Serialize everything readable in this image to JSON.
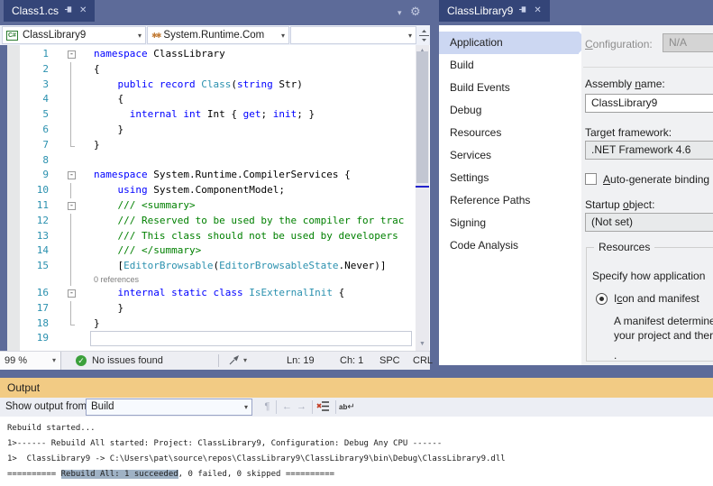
{
  "window": {
    "background": "#5d6b99",
    "active_tab_color": "#344578",
    "output_title_color": "#f2cb84"
  },
  "icons": {
    "chevron_down": "▾",
    "close": "✕",
    "check": "✓",
    "gear": "⚙",
    "up_arrow": "▲",
    "down_arrow": "▼",
    "prev_arrow": "←",
    "next_arrow": "→",
    "find_message": "¶",
    "return_arrow": "↵",
    "wrap_ab": "ab",
    "fold_collapse": "-"
  },
  "left_editor": {
    "tab_title": "Class1.cs",
    "navbar": {
      "project": "ClassLibrary9",
      "type_name": "System.Runtime.Com",
      "member": ""
    },
    "code": {
      "codelens": "0 references",
      "rows": [
        {
          "num": "1",
          "fold": "box",
          "segs": [
            [
              "kw",
              "namespace"
            ],
            [
              "pl",
              " ClassLibrary"
            ]
          ]
        },
        {
          "num": "2",
          "fold": "bar",
          "segs": [
            [
              "pl",
              "{"
            ]
          ]
        },
        {
          "num": "3",
          "fold": "bar",
          "segs": [
            [
              "pl",
              "    "
            ],
            [
              "kw",
              "public"
            ],
            [
              "pl",
              " "
            ],
            [
              "kw",
              "record"
            ],
            [
              "pl",
              " "
            ],
            [
              "ty",
              "Class"
            ],
            [
              "pl",
              "("
            ],
            [
              "kw",
              "string"
            ],
            [
              "pl",
              " Str)"
            ]
          ]
        },
        {
          "num": "4",
          "fold": "bar",
          "segs": [
            [
              "pl",
              "    {"
            ]
          ]
        },
        {
          "num": "5",
          "fold": "bar",
          "segs": [
            [
              "pl",
              "      "
            ],
            [
              "kw",
              "internal"
            ],
            [
              "pl",
              " "
            ],
            [
              "kw",
              "int"
            ],
            [
              "pl",
              " Int { "
            ],
            [
              "kw",
              "get"
            ],
            [
              "pl",
              "; "
            ],
            [
              "kw",
              "init"
            ],
            [
              "pl",
              "; }"
            ]
          ]
        },
        {
          "num": "6",
          "fold": "bar",
          "segs": [
            [
              "pl",
              "    }"
            ]
          ]
        },
        {
          "num": "7",
          "fold": "end",
          "segs": [
            [
              "pl",
              "}"
            ]
          ]
        },
        {
          "num": "8",
          "fold": "",
          "segs": []
        },
        {
          "num": "9",
          "fold": "box",
          "segs": [
            [
              "kw",
              "namespace"
            ],
            [
              "pl",
              " System.Runtime.CompilerServices {"
            ]
          ]
        },
        {
          "num": "10",
          "fold": "bar",
          "segs": [
            [
              "pl",
              "    "
            ],
            [
              "kw",
              "using"
            ],
            [
              "pl",
              " System.ComponentModel;"
            ]
          ]
        },
        {
          "num": "11",
          "fold": "box",
          "segs": [
            [
              "cm",
              "    /// <summary>"
            ]
          ]
        },
        {
          "num": "12",
          "fold": "bar",
          "segs": [
            [
              "cm",
              "    /// Reserved to be used by the compiler for trac"
            ]
          ]
        },
        {
          "num": "13",
          "fold": "bar",
          "segs": [
            [
              "cm",
              "    /// This class should not be used by developers"
            ]
          ]
        },
        {
          "num": "14",
          "fold": "bar",
          "segs": [
            [
              "cm",
              "    /// </summary>"
            ]
          ]
        },
        {
          "num": "15",
          "fold": "bar",
          "segs": [
            [
              "pl",
              "    ["
            ],
            [
              "ty",
              "EditorBrowsable"
            ],
            [
              "pl",
              "("
            ],
            [
              "ty",
              "EditorBrowsableState"
            ],
            [
              "pl",
              ".Never)]"
            ]
          ]
        },
        {
          "num": "",
          "fold": "bar",
          "lens": true,
          "segs": []
        },
        {
          "num": "16",
          "fold": "box",
          "segs": [
            [
              "pl",
              "    "
            ],
            [
              "kw",
              "internal"
            ],
            [
              "pl",
              " "
            ],
            [
              "kw",
              "static"
            ],
            [
              "pl",
              " "
            ],
            [
              "kw",
              "class"
            ],
            [
              "pl",
              " "
            ],
            [
              "ty",
              "IsExternalInit"
            ],
            [
              "pl",
              " {"
            ]
          ]
        },
        {
          "num": "17",
          "fold": "bar",
          "segs": [
            [
              "pl",
              "    }"
            ]
          ]
        },
        {
          "num": "18",
          "fold": "end",
          "segs": [
            [
              "pl",
              "}"
            ]
          ]
        },
        {
          "num": "19",
          "fold": "",
          "segs": []
        }
      ]
    },
    "statusbar": {
      "zoom": "99 %",
      "health": "No issues found",
      "line": "Ln: 19",
      "column": "Ch: 1",
      "insert": "SPC",
      "eol": "CRL"
    }
  },
  "properties": {
    "tab_title": "ClassLibrary9",
    "menu": [
      "Application",
      "Build",
      "Build Events",
      "Debug",
      "Resources",
      "Services",
      "Settings",
      "Reference Paths",
      "Signing",
      "Code Analysis"
    ],
    "selected_index": 0,
    "form": {
      "configuration": {
        "pre": "",
        "key": "C",
        "post": "onfiguration:",
        "value": "N/A"
      },
      "assembly": {
        "pre": "Assembly ",
        "key": "n",
        "post": "ame:",
        "value": "ClassLibrary9"
      },
      "framework": {
        "pre": "Tar",
        "key": "g",
        "post": "et framework:",
        "value": ".NET Framework 4.6"
      },
      "autogen": {
        "pre": "",
        "key": "A",
        "post": "uto-generate binding",
        "checked": false
      },
      "startup": {
        "pre": "Startup ",
        "key": "o",
        "post": "bject:",
        "value": "(Not set)"
      },
      "resources": {
        "legend": "Resources",
        "caption": "Specify how application",
        "radio": {
          "pre": "I",
          "key": "c",
          "post": "on and manifest",
          "selected": true
        },
        "desc": [
          "A manifest determine",
          "your project and ther",
          "."
        ]
      }
    }
  },
  "output": {
    "title": "Output",
    "show_from_label": "Show output from:",
    "source": "Build",
    "selection_color": "#9fb2c5",
    "lines": [
      {
        "text": "Rebuild started..."
      },
      {
        "text": "1>------ Rebuild All started: Project: ClassLibrary9, Configuration: Debug Any CPU ------"
      },
      {
        "text": "1>  ClassLibrary9 -> C:\\Users\\pat\\source\\repos\\ClassLibrary9\\ClassLibrary9\\bin\\Debug\\ClassLibrary9.dll"
      },
      {
        "pre": "========== ",
        "sel": "Rebuild All: 1 succeeded",
        "post": ", 0 failed, 0 skipped =========="
      }
    ]
  }
}
